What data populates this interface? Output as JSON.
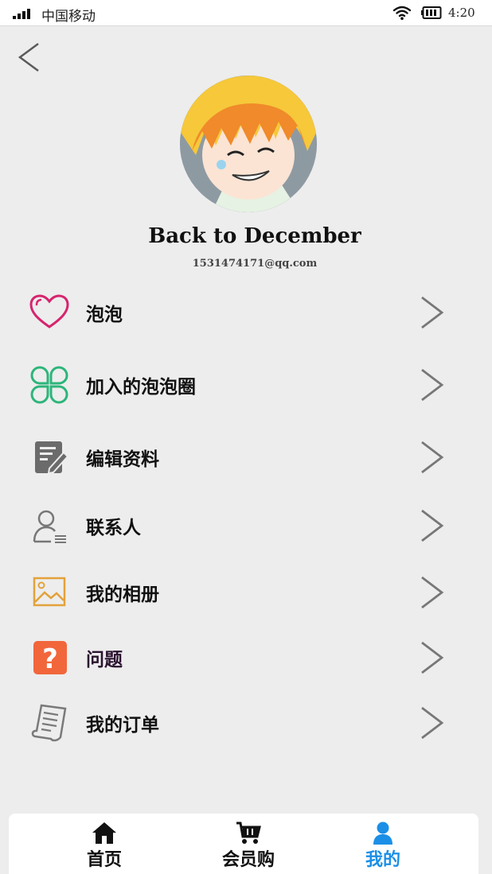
{
  "status_bar": {
    "carrier": "中国移动",
    "time": "4:20"
  },
  "profile": {
    "name": "Back to December",
    "email": "1531474171@qq.com"
  },
  "menu": {
    "items": [
      {
        "label": "泡泡",
        "icon": "heart-icon",
        "color": "#d6246e"
      },
      {
        "label": "加入的泡泡圈",
        "icon": "clover-icon",
        "color": "#2db57a"
      },
      {
        "label": "编辑资料",
        "icon": "edit-note-icon",
        "color": "#6b6b6b"
      },
      {
        "label": "联系人",
        "icon": "contacts-icon",
        "color": "#777777"
      },
      {
        "label": "我的相册",
        "icon": "photo-album-icon",
        "color": "#e3a23b"
      },
      {
        "label": "问题",
        "icon": "question-icon",
        "color": "#f2663b"
      },
      {
        "label": "我的订单",
        "icon": "order-list-icon",
        "color": "#7a7a7a"
      }
    ]
  },
  "tabbar": {
    "tabs": [
      {
        "label": "首页",
        "icon": "home-icon"
      },
      {
        "label": "会员购",
        "icon": "cart-icon"
      },
      {
        "label": "我的",
        "icon": "user-icon",
        "active": true
      }
    ],
    "active_color": "#1b8fe6"
  }
}
